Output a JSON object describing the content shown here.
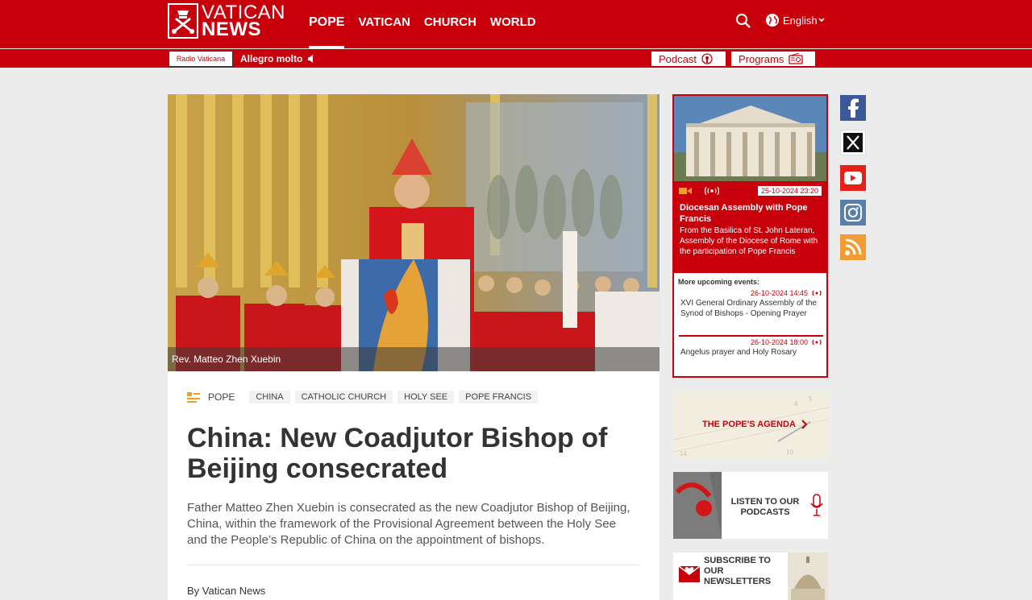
{
  "header": {
    "logo_line1": "VATICAN",
    "logo_line2": "NEWS",
    "nav": [
      {
        "label": "POPE",
        "active": true
      },
      {
        "label": "VATICAN",
        "active": false
      },
      {
        "label": "CHURCH",
        "active": false
      },
      {
        "label": "WORLD",
        "active": false
      }
    ],
    "language": "English"
  },
  "radio": {
    "badge": "Radio Vaticana",
    "now_playing": "Allegro molto",
    "podcast_label": "Podcast",
    "programs_label": "Programs"
  },
  "article": {
    "image_caption": "Rev. Matteo Zhen Xuebin",
    "section": "POPE",
    "tags": [
      "CHINA",
      "CATHOLIC CHURCH",
      "HOLY SEE",
      "POPE FRANCIS"
    ],
    "headline": "China: New Coadjutor Bishop of Beijing consecrated",
    "lead": "Father Matteo Zhen Xuebin is consecrated as the new Coadjutor Bishop of Beijing, China, within the framework of the Provisional Agreement between the Holy See and the People’s Republic of China on the appointment of bishops.",
    "byline": "By Vatican News"
  },
  "live": {
    "date": "25-10-2024 23:20",
    "title": "Diocesan Assembly with Pope Francis",
    "description": "From the Basilica of St. John Lateran, Assembly of the Diocese of Rome with the participation of Pope Francis",
    "more_label": "More upcoming events:",
    "events": [
      {
        "time": "26-10-2024 14:45",
        "title": "XVI General Ordinary Assembly of the Synod of Bishops - Opening Prayer"
      },
      {
        "time": "26-10-2024 18:00",
        "title": "Angelus prayer and Holy Rosary"
      }
    ]
  },
  "promos": {
    "agenda": "THE POPE'S AGENDA",
    "podcasts": "LISTEN TO OUR PODCASTS",
    "newsletter": "SUBSCRIBE TO OUR NEWSLETTERS"
  },
  "social": [
    "facebook-icon",
    "x-icon",
    "youtube-icon",
    "instagram-icon",
    "rss-icon"
  ],
  "colors": {
    "brand_red": "#c8000b",
    "background": "#ececec"
  }
}
